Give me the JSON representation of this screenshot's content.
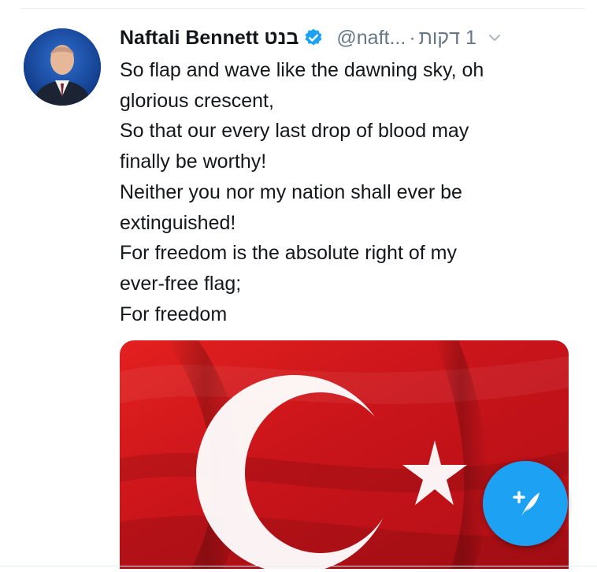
{
  "tweet": {
    "display_name": "Naftali Bennett",
    "display_name_he": "בנט",
    "handle": "@naft...",
    "separator": "·",
    "time": "1 דקות",
    "text_lines": [
      "So flap and wave like the dawning sky, oh",
      "glorious crescent,",
      "So that our every last drop of blood may",
      "finally be worthy!",
      "Neither you nor my nation shall ever be",
      "extinguished!",
      "For freedom is the absolute right of my",
      "ever-free flag;",
      "For freedom"
    ]
  },
  "icons": {
    "verified": "verified-badge-icon",
    "caret": "chevron-down-icon",
    "compose": "compose-tweet-icon"
  },
  "colors": {
    "accent": "#1da1f2",
    "text": "#14171a",
    "muted": "#657786",
    "flag_red": "#d0161b",
    "avatar_bg": "#0b3a8c"
  }
}
